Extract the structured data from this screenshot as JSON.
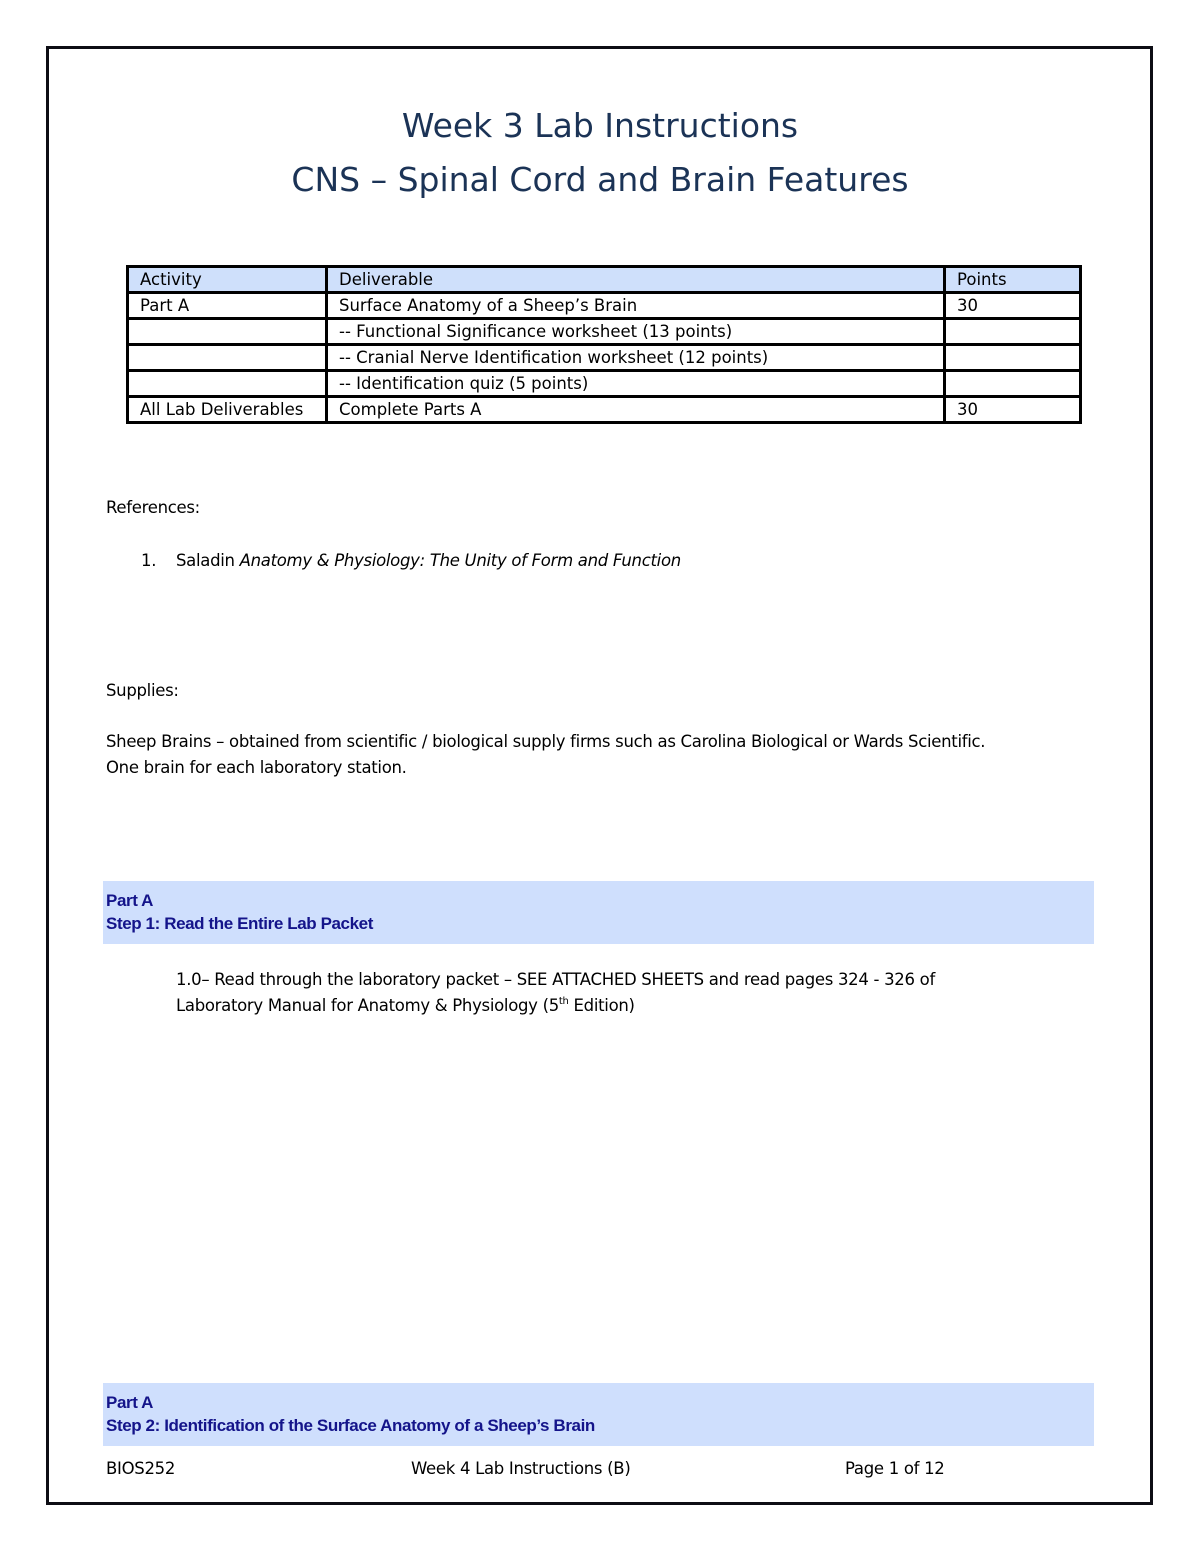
{
  "document": {
    "title": "Week 3 Lab Instructions",
    "subtitle": "CNS – Spinal Cord and Brain Features"
  },
  "deliverables_table": {
    "headers": [
      "Activity",
      "Deliverable",
      "Points"
    ],
    "rows": [
      {
        "activity": "Part A",
        "deliverable": "Surface Anatomy of a Sheep’s Brain",
        "points": "30"
      },
      {
        "activity": "",
        "deliverable": " -- Functional Significance worksheet (13 points)",
        "points": ""
      },
      {
        "activity": "",
        "deliverable": " -- Cranial Nerve Identification worksheet (12 points)",
        "points": ""
      },
      {
        "activity": "",
        "deliverable": " -- Identification quiz (5 points)",
        "points": ""
      },
      {
        "activity": "All Lab Deliverables",
        "deliverable": "Complete Parts A",
        "points": "30"
      }
    ]
  },
  "references": {
    "label": "References:",
    "items": [
      {
        "number": "1.",
        "author": "Saladin ",
        "title": "Anatomy & Physiology: The Unity of Form and Function"
      }
    ]
  },
  "supplies": {
    "label": "Supplies:",
    "lines": [
      "Sheep Brains – obtained from scientific / biological supply firms such as Carolina Biological or Wards Scientific.",
      "One brain for each laboratory station."
    ]
  },
  "sections": [
    {
      "part": "Part A",
      "step": "Step 1: Read the Entire Lab Packet",
      "body": {
        "line1": "1.0– Read through the laboratory packet – SEE ATTACHED SHEETS and read pages 324 - 326 of",
        "line2_before": "Laboratory Manual for Anatomy & Physiology (5",
        "line2_sup": "th",
        "line2_after": " Edition)"
      }
    },
    {
      "part": "Part A",
      "step": "Step 2: Identification of the Surface Anatomy of a Sheep’s Brain"
    }
  ],
  "footer": {
    "course": "BIOS252",
    "doc_name": "Week 4 Lab Instructions (B)",
    "page": "Page 1 of 12"
  }
}
